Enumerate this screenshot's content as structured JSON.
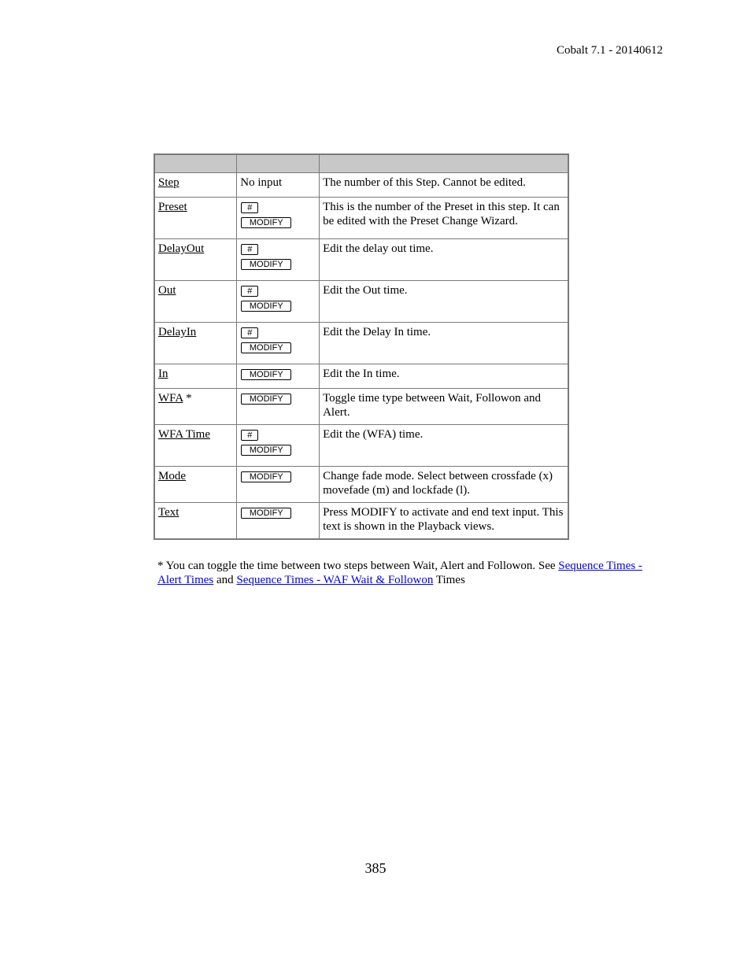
{
  "header": {
    "doc_version": "Cobalt 7.1 - 20140612"
  },
  "table": {
    "header_columns": [
      "",
      "",
      ""
    ],
    "rows": [
      {
        "field": "Step",
        "suffix": "",
        "input_text": "No input",
        "keys": [],
        "description": "The number of this Step. Cannot be edited."
      },
      {
        "field": "Preset",
        "suffix": "",
        "input_text": "",
        "keys": [
          "#",
          "MODIFY"
        ],
        "description": "This is the number of the Preset in this step. It can be edited with the Preset Change Wizard."
      },
      {
        "field": "DelayOut",
        "suffix": "",
        "input_text": "",
        "keys": [
          "#",
          "MODIFY"
        ],
        "description": "Edit the delay out time."
      },
      {
        "field": "Out",
        "suffix": "",
        "input_text": "",
        "keys": [
          "#",
          "MODIFY"
        ],
        "description": "Edit the Out time."
      },
      {
        "field": "DelayIn",
        "suffix": "",
        "input_text": "",
        "keys": [
          "#",
          "MODIFY"
        ],
        "description": "Edit the Delay In time."
      },
      {
        "field": "In",
        "suffix": "",
        "input_text": "",
        "keys": [
          "MODIFY"
        ],
        "description": "Edit the In time."
      },
      {
        "field": "WFA",
        "suffix": " *",
        "input_text": "",
        "keys": [
          "MODIFY"
        ],
        "description": "Toggle time type between Wait, Followon and Alert."
      },
      {
        "field": "WFA Time",
        "suffix": "",
        "input_text": "",
        "keys": [
          "#",
          "MODIFY"
        ],
        "description": "Edit the (WFA) time."
      },
      {
        "field": "Mode",
        "suffix": "",
        "input_text": "",
        "keys": [
          "MODIFY"
        ],
        "description": "Change fade mode. Select between crossfade (x) movefade (m) and lockfade (l)."
      },
      {
        "field": "Text",
        "suffix": "",
        "input_text": "",
        "keys": [
          "MODIFY"
        ],
        "description": "Press MODIFY to activate and end text input. This text is shown in the Playback views."
      }
    ]
  },
  "footnote": {
    "text_before": "* You can toggle the time between two steps between Wait, Alert and Followon. See ",
    "link1": "Sequence Times - Alert Times",
    "text_middle": " and ",
    "link2": "Sequence Times - WAF Wait & Followon",
    "text_after": " Times"
  },
  "page_number": "385",
  "colors": {
    "link": "#0000ee",
    "table_border": "#7a7a7a",
    "header_bg": "#c8c8c8"
  }
}
